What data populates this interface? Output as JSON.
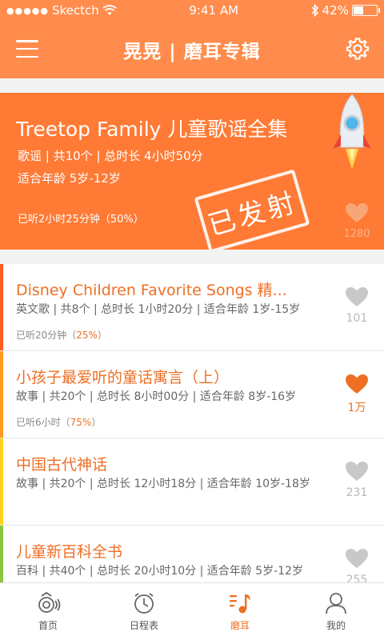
{
  "status_bar": {
    "carrier": "Skectch",
    "time": "9:41 AM",
    "battery": "42%",
    "signal_dots": "●●●●●"
  },
  "header": {
    "title": "晃晃 | 磨耳专辑"
  },
  "featured": {
    "title": "Treetop Family 儿童歌谣全集",
    "meta": "歌谣 | 共10个 | 总时长 4小时50分",
    "age": "适合年龄 5岁-12岁",
    "progress": "已听2小时25分钟（50%）",
    "stamp": "已发射",
    "likes": "1280"
  },
  "albums": [
    {
      "title": "Disney Children Favorite Songs 精...",
      "meta": "英文歌 | 共8个 | 总时长 1小时20分 | 适合年龄 1岁-15岁",
      "progress_prefix": "已听20分钟（",
      "progress_pct": "25%",
      "progress_suffix": "）",
      "likes": "101",
      "bar_color": "#ff5a1f",
      "liked": false
    },
    {
      "title": "小孩子最爱听的童话寓言（上）",
      "meta": "故事 | 共20个 | 总时长 8小时00分 | 适合年龄 8岁-16岁",
      "progress_prefix": "已听6小时（",
      "progress_pct": "75%",
      "progress_suffix": "）",
      "likes": "1万",
      "bar_color": "#ff9a1f",
      "liked": true
    },
    {
      "title": "中国古代神话",
      "meta": "故事 | 共20个 | 总时长 12小时18分 | 适合年龄 10岁-18岁",
      "progress_prefix": "",
      "progress_pct": "",
      "progress_suffix": "",
      "likes": "231",
      "bar_color": "#ffd21f",
      "liked": false
    },
    {
      "title": "儿童新百科全书",
      "meta": "百科 | 共40个 | 总时长 20小时10分 | 适合年龄 5岁-12岁",
      "progress_prefix": "",
      "progress_pct": "",
      "progress_suffix": "",
      "likes": "255",
      "bar_color": "#8cc63f",
      "liked": false
    }
  ],
  "tabs": [
    {
      "label": "首页",
      "icon": "home-icon",
      "active": false
    },
    {
      "label": "日程表",
      "icon": "clock-icon",
      "active": false
    },
    {
      "label": "磨耳",
      "icon": "music-list-icon",
      "active": true
    },
    {
      "label": "我的",
      "icon": "user-icon",
      "active": false
    }
  ],
  "colors": {
    "header": "#ff8c4c",
    "featured": "#ff7a35",
    "accent": "#ee6f24",
    "heart_inactive": "#c8c8c8"
  }
}
